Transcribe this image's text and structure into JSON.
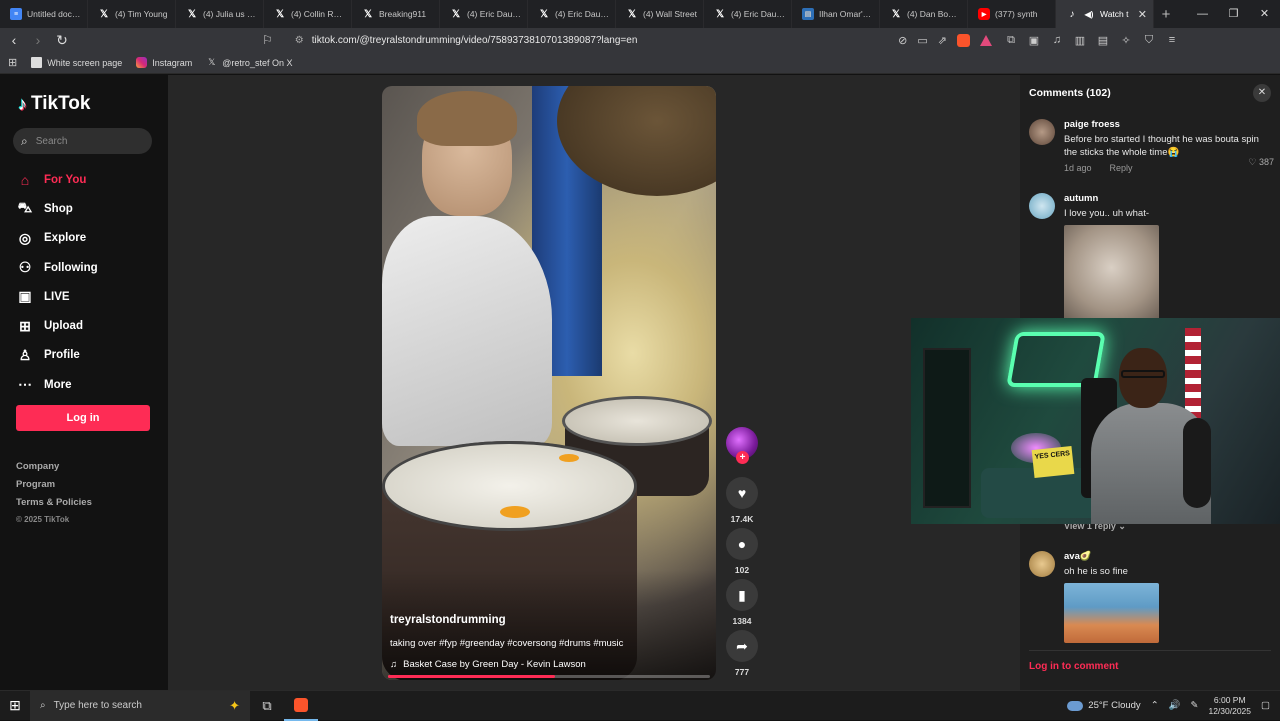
{
  "browser": {
    "tabs": [
      {
        "title": "Untitled docum",
        "icon": "docs-icon"
      },
      {
        "title": "(4) Tim Young",
        "icon": "x-icon"
      },
      {
        "title": "(4) Julia us on X",
        "icon": "x-icon"
      },
      {
        "title": "(4) Collin Rugg",
        "icon": "x-icon"
      },
      {
        "title": "Breaking911",
        "icon": "x-icon"
      },
      {
        "title": "(4) Eric Daugh",
        "icon": "x-icon"
      },
      {
        "title": "(4) Eric Daugh",
        "icon": "x-icon"
      },
      {
        "title": "(4) Wall Street",
        "icon": "x-icon"
      },
      {
        "title": "(4) Eric Daugh",
        "icon": "x-icon"
      },
      {
        "title": "Ilhan Omar's h",
        "icon": "ilhan-icon"
      },
      {
        "title": "(4) Dan Bongin",
        "icon": "x-icon"
      },
      {
        "title": "(377) synth",
        "icon": "youtube-icon"
      }
    ],
    "active_tab": "Watch t",
    "new_tab_label": "+",
    "url": "tiktok.com/@treyralstondrumming/video/7589373810701389087?lang=en",
    "bookmarks": [
      {
        "label": "White screen page",
        "icon": "page-icon"
      },
      {
        "label": "Instagram",
        "icon": "instagram-icon"
      },
      {
        "label": "@retro_stef On X",
        "icon": "x-icon"
      }
    ]
  },
  "sidebar": {
    "logo": "TikTok",
    "search_placeholder": "Search",
    "nav": [
      {
        "label": "For You",
        "icon": "home-icon",
        "active": true
      },
      {
        "label": "Shop",
        "icon": "shop-icon"
      },
      {
        "label": "Explore",
        "icon": "compass-icon"
      },
      {
        "label": "Following",
        "icon": "following-icon"
      },
      {
        "label": "LIVE",
        "icon": "live-icon"
      },
      {
        "label": "Upload",
        "icon": "upload-icon"
      },
      {
        "label": "Profile",
        "icon": "profile-icon"
      },
      {
        "label": "More",
        "icon": "more-icon"
      }
    ],
    "login_label": "Log in",
    "footer": [
      "Company",
      "Program",
      "Terms & Policies"
    ],
    "copyright": "© 2025 TikTok"
  },
  "video": {
    "username": "treyralstondrumming",
    "description": "taking over #fyp #greenday #coversong #drums #music",
    "music": "Basket Case by Green Day - Kevin Lawson",
    "progress": 0.52,
    "likes": "17.4K",
    "comments": "102",
    "saves": "1384",
    "shares": "777"
  },
  "comments": {
    "title": "Comments (102)",
    "items": [
      {
        "name": "paige froess",
        "text": "Before bro started I thought he was bouta spin the sticks the whole time😭",
        "time": "1d ago",
        "reply": "Reply",
        "likes": "387"
      },
      {
        "name": "autumn",
        "text": "I love you.. uh what-"
      },
      {
        "name": "ava🥑",
        "text": "oh he is so fine"
      }
    ],
    "view_reply": "View 1 reply",
    "login_prompt": "Log in to comment"
  },
  "webcam": {
    "sign_text": "YES CERS"
  },
  "taskbar": {
    "search_placeholder": "Type here to search",
    "weather": "25°F  Cloudy",
    "time": "6:00 PM",
    "date": "12/30/2025"
  }
}
